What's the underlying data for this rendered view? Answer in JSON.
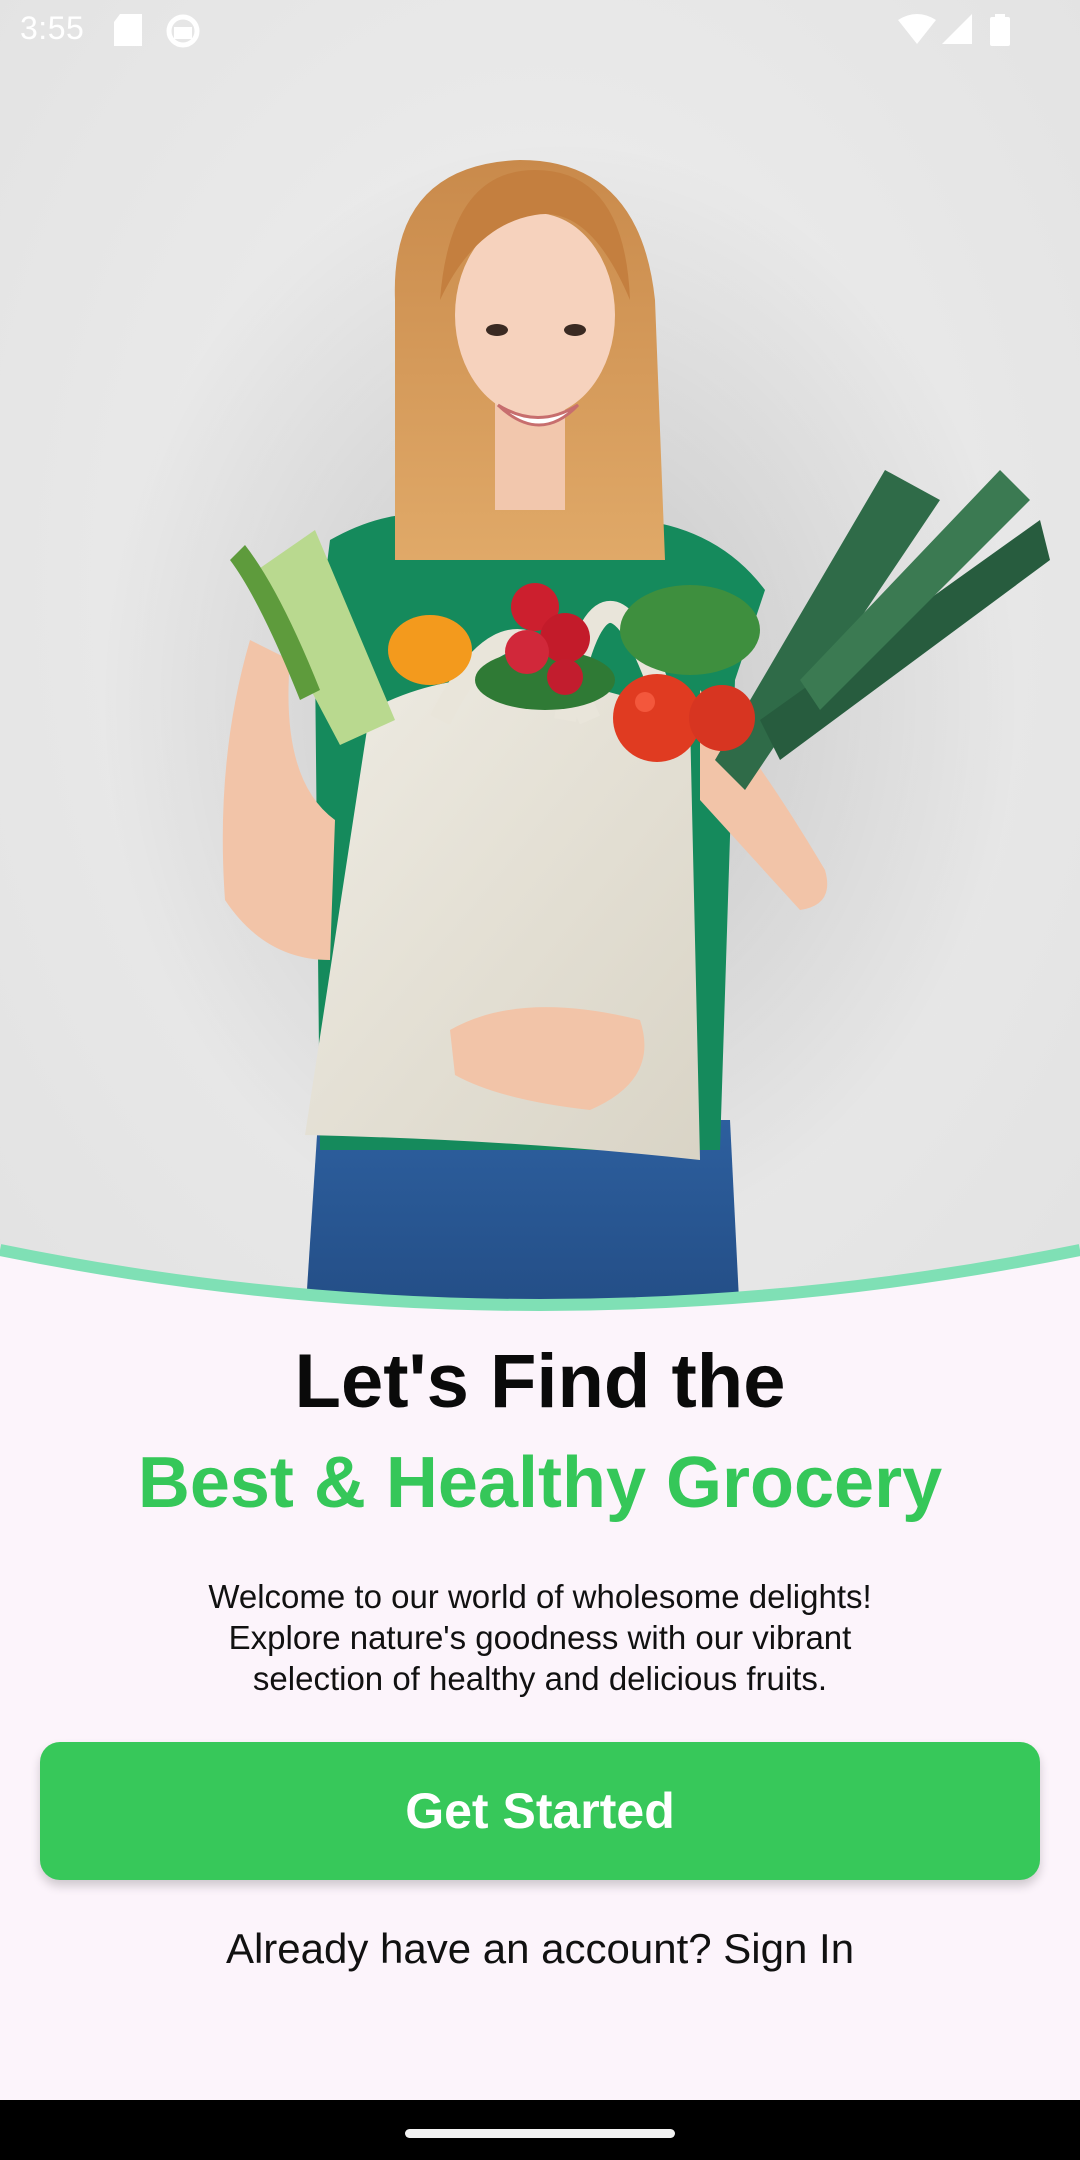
{
  "status_bar": {
    "time": "3:55",
    "left_icons": [
      "sd-card-icon",
      "android-debug-icon"
    ],
    "right_icons": [
      "wifi-icon",
      "signal-icon",
      "battery-icon"
    ]
  },
  "hero": {
    "image": "woman-holding-grocery-bag-image"
  },
  "headline": {
    "line1": "Let's Find the",
    "line2": "Best & Healthy Grocery"
  },
  "welcome_text": {
    "line1": "Welcome to our world of wholesome delights!",
    "line2": "Explore nature's goodness with our vibrant",
    "line3": "selection of healthy and delicious fruits."
  },
  "cta": {
    "label": "Get Started"
  },
  "signin": {
    "label": "Already have an account? Sign In"
  },
  "colors": {
    "accent": "#35c759",
    "button": "#37c85a",
    "wave": "#7fe0b5",
    "background": "#fcf4fb"
  }
}
